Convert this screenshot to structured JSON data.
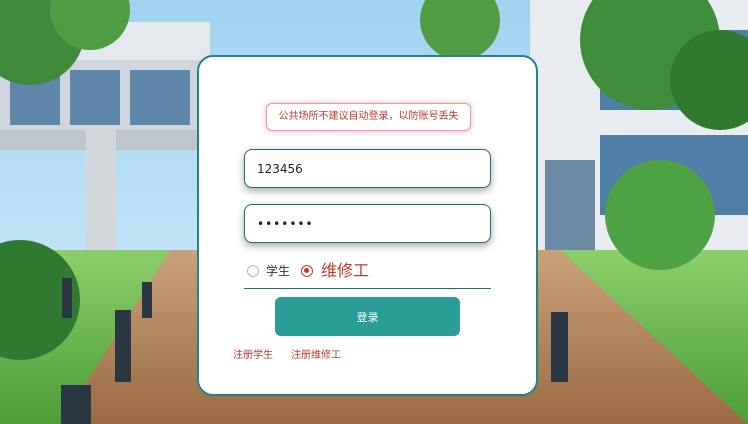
{
  "notice": "公共场所不建议自动登录，以防账号丢失",
  "form": {
    "username_value": "123456",
    "password_value": "•••••••"
  },
  "roles": {
    "student_label": "学生",
    "worker_label": "维修工",
    "selected": "worker"
  },
  "login_button_label": "登录",
  "links": {
    "register_student": "注册学生",
    "register_worker": "注册维修工"
  },
  "colors": {
    "accent": "#2a9d97",
    "border": "#1f6f78",
    "warning": "#c0392b"
  }
}
